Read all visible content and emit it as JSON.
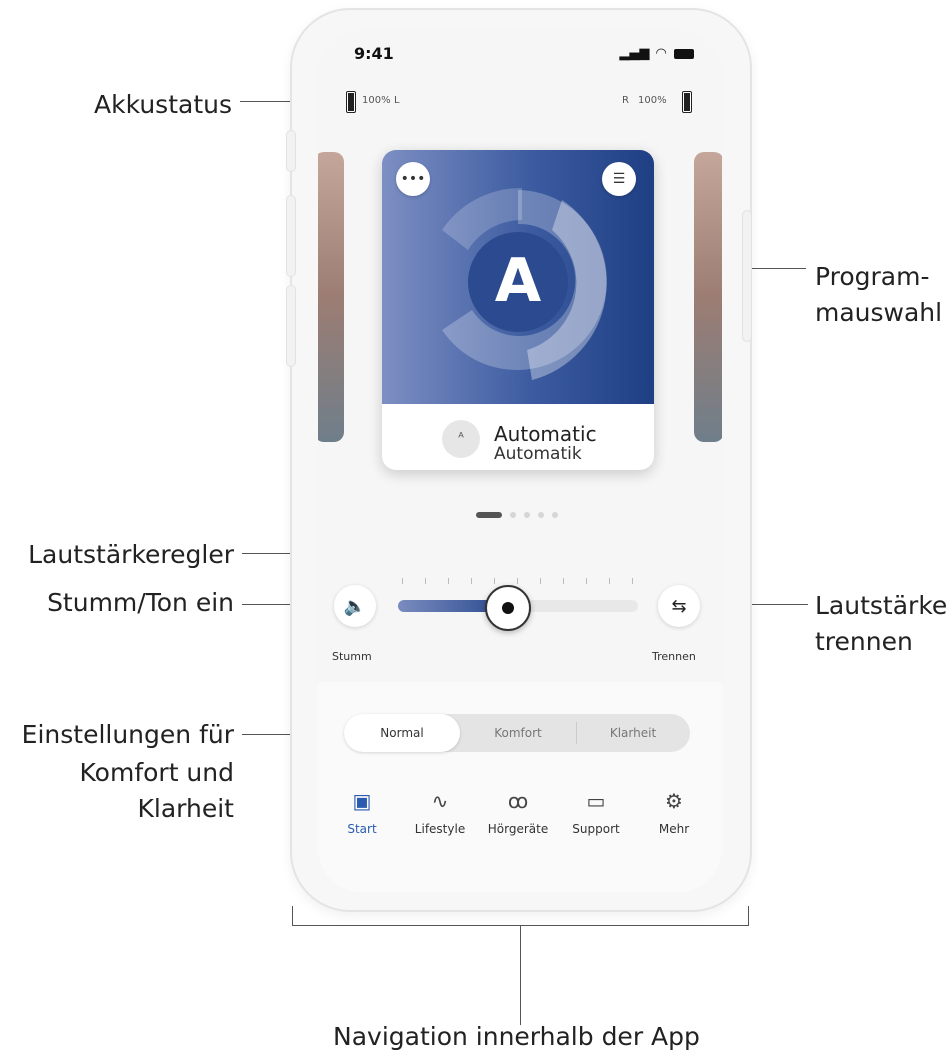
{
  "callouts": {
    "battery_status": "Akkustatus",
    "program_select_line1": "Program-",
    "program_select_line2": "mauswahl",
    "volume_slider": "Lautstärkeregler",
    "mute_unmute": "Stumm/Ton ein",
    "volume_split_line1": "Lautstärke",
    "volume_split_line2": "trennen",
    "settings_line1": "Einstellungen für",
    "settings_line2": "Komfort und",
    "settings_line3": "Klarheit",
    "navigation": "Navigation innerhalb der App"
  },
  "status_bar": {
    "time": "9:41"
  },
  "battery": {
    "left_value": "100%",
    "left_side": "L",
    "right_side": "R",
    "right_value": "100%"
  },
  "program_card": {
    "letter": "A",
    "title": "Automatic",
    "subtitle": "Automatik",
    "more_icon": "more-icon",
    "settings_icon": "sliders-icon",
    "colors": {
      "dark": "#1f3f84",
      "light": "#7d8fc3"
    }
  },
  "pager": {
    "count": 5,
    "active_index": 0
  },
  "volume": {
    "level_fraction": 0.45,
    "mute_label": "Stumm",
    "split_label": "Trennen"
  },
  "modes": {
    "options": [
      "Normal",
      "Komfort",
      "Klarheit"
    ],
    "selected": "Normal"
  },
  "nav": {
    "items": [
      {
        "label": "Start",
        "icon": "grid-icon"
      },
      {
        "label": "Lifestyle",
        "icon": "activity-icon"
      },
      {
        "label": "Hörgeräte",
        "icon": "hearing-aid-icon"
      },
      {
        "label": "Support",
        "icon": "chat-icon"
      },
      {
        "label": "Mehr",
        "icon": "gear-icon"
      }
    ],
    "active_index": 0,
    "accent": "#2a5bb0"
  }
}
